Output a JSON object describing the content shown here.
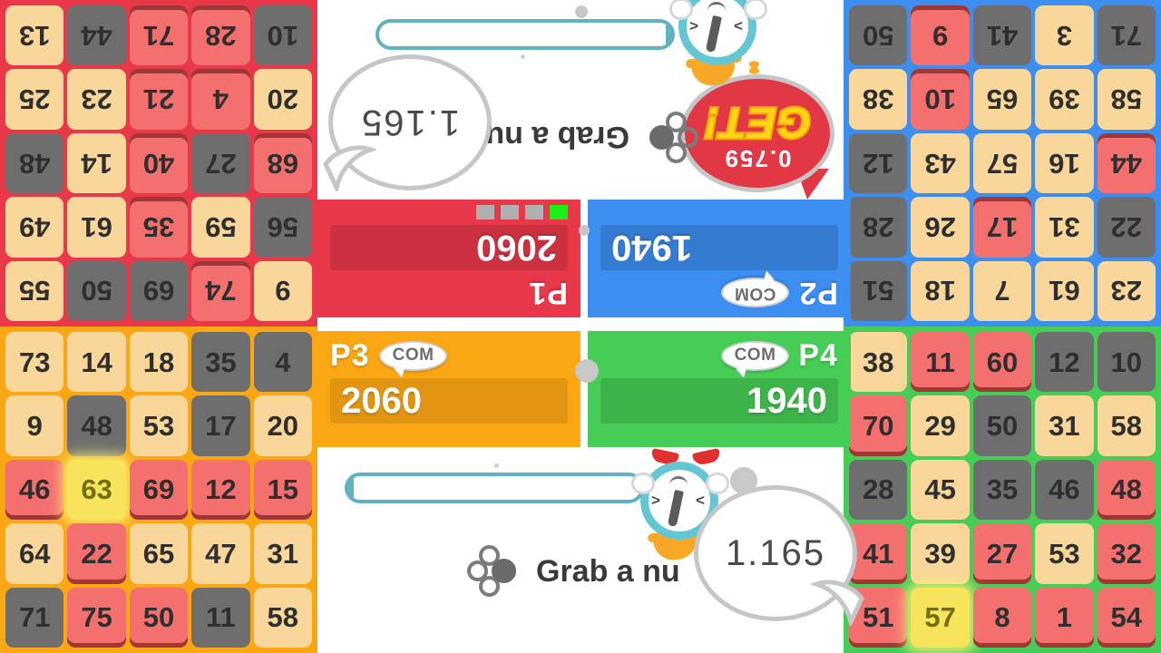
{
  "game": {
    "prompt_text": "Grab a nu",
    "get_label": "GET!",
    "get_time": "0.759",
    "bubble_top": "1.165",
    "bubble_bottom": "1.165",
    "icon_names": [
      "four-dot-icon",
      "clock-mascot-icon",
      "speech-bubble-icon"
    ]
  },
  "colors": {
    "p1": "#e8384a",
    "p2": "#3c8ef0",
    "p3": "#fba613",
    "p4": "#45cd55",
    "tile_cream": "#f9d79a",
    "tile_gray": "#6e6e6e",
    "tile_red": "#f4706f",
    "tile_highlight": "#f7e35c",
    "accent_teal": "#5fb3bf",
    "get_yellow": "#ffd417"
  },
  "players": [
    {
      "id": "p1",
      "name": "P1",
      "score": "2060",
      "com": false,
      "rotated": true,
      "progress_dots": [
        true,
        false,
        false,
        false
      ]
    },
    {
      "id": "p2",
      "name": "P2",
      "score": "1940",
      "com": true,
      "com_label": "COM",
      "rotated": true
    },
    {
      "id": "p3",
      "name": "P3",
      "score": "2060",
      "com": true,
      "com_label": "COM",
      "rotated": false
    },
    {
      "id": "p4",
      "name": "P4",
      "score": "1940",
      "com": true,
      "com_label": "COM",
      "rotated": false
    }
  ],
  "boards": {
    "p1": {
      "rows": [
        [
          {
            "v": "9",
            "s": "cream"
          },
          {
            "v": "74",
            "s": "red"
          },
          {
            "v": "69",
            "s": "gray"
          },
          {
            "v": "50",
            "s": "gray"
          },
          {
            "v": "55",
            "s": "cream"
          }
        ],
        [
          {
            "v": "56",
            "s": "gray"
          },
          {
            "v": "59",
            "s": "cream"
          },
          {
            "v": "35",
            "s": "red"
          },
          {
            "v": "61",
            "s": "cream"
          },
          {
            "v": "49",
            "s": "cream"
          }
        ],
        [
          {
            "v": "68",
            "s": "red"
          },
          {
            "v": "27",
            "s": "gray"
          },
          {
            "v": "40",
            "s": "red"
          },
          {
            "v": "14",
            "s": "cream"
          },
          {
            "v": "48",
            "s": "gray"
          }
        ],
        [
          {
            "v": "20",
            "s": "cream"
          },
          {
            "v": "4",
            "s": "red"
          },
          {
            "v": "21",
            "s": "red"
          },
          {
            "v": "23",
            "s": "cream"
          },
          {
            "v": "25",
            "s": "cream"
          }
        ],
        [
          {
            "v": "10",
            "s": "gray"
          },
          {
            "v": "28",
            "s": "red"
          },
          {
            "v": "71",
            "s": "red"
          },
          {
            "v": "44",
            "s": "gray"
          },
          {
            "v": "13",
            "s": "cream"
          }
        ]
      ]
    },
    "p2": {
      "rows": [
        [
          {
            "v": "23",
            "s": "cream"
          },
          {
            "v": "61",
            "s": "cream"
          },
          {
            "v": "7",
            "s": "cream"
          },
          {
            "v": "18",
            "s": "cream"
          },
          {
            "v": "51",
            "s": "gray"
          }
        ],
        [
          {
            "v": "22",
            "s": "gray"
          },
          {
            "v": "31",
            "s": "cream"
          },
          {
            "v": "17",
            "s": "red"
          },
          {
            "v": "26",
            "s": "cream"
          },
          {
            "v": "28",
            "s": "gray"
          }
        ],
        [
          {
            "v": "44",
            "s": "red"
          },
          {
            "v": "16",
            "s": "cream"
          },
          {
            "v": "57",
            "s": "cream"
          },
          {
            "v": "43",
            "s": "cream"
          },
          {
            "v": "12",
            "s": "gray"
          }
        ],
        [
          {
            "v": "58",
            "s": "cream"
          },
          {
            "v": "39",
            "s": "cream"
          },
          {
            "v": "65",
            "s": "cream"
          },
          {
            "v": "10",
            "s": "red"
          },
          {
            "v": "38",
            "s": "cream"
          }
        ],
        [
          {
            "v": "71",
            "s": "gray"
          },
          {
            "v": "3",
            "s": "cream"
          },
          {
            "v": "41",
            "s": "gray"
          },
          {
            "v": "9",
            "s": "red"
          },
          {
            "v": "50",
            "s": "gray"
          }
        ]
      ]
    },
    "p3": {
      "rows": [
        [
          {
            "v": "73",
            "s": "cream"
          },
          {
            "v": "14",
            "s": "cream"
          },
          {
            "v": "18",
            "s": "cream"
          },
          {
            "v": "35",
            "s": "gray"
          },
          {
            "v": "4",
            "s": "gray"
          }
        ],
        [
          {
            "v": "9",
            "s": "cream"
          },
          {
            "v": "48",
            "s": "gray"
          },
          {
            "v": "53",
            "s": "cream"
          },
          {
            "v": "17",
            "s": "gray"
          },
          {
            "v": "20",
            "s": "cream"
          }
        ],
        [
          {
            "v": "46",
            "s": "red"
          },
          {
            "v": "63",
            "s": "highlight"
          },
          {
            "v": "69",
            "s": "red"
          },
          {
            "v": "12",
            "s": "red"
          },
          {
            "v": "15",
            "s": "red"
          }
        ],
        [
          {
            "v": "64",
            "s": "cream"
          },
          {
            "v": "22",
            "s": "red"
          },
          {
            "v": "65",
            "s": "cream"
          },
          {
            "v": "47",
            "s": "cream"
          },
          {
            "v": "31",
            "s": "cream"
          }
        ],
        [
          {
            "v": "71",
            "s": "gray"
          },
          {
            "v": "75",
            "s": "red"
          },
          {
            "v": "50",
            "s": "red"
          },
          {
            "v": "11",
            "s": "gray"
          },
          {
            "v": "58",
            "s": "cream"
          }
        ]
      ]
    },
    "p4": {
      "rows": [
        [
          {
            "v": "38",
            "s": "cream"
          },
          {
            "v": "11",
            "s": "red"
          },
          {
            "v": "60",
            "s": "red"
          },
          {
            "v": "12",
            "s": "gray"
          },
          {
            "v": "10",
            "s": "gray"
          }
        ],
        [
          {
            "v": "70",
            "s": "red"
          },
          {
            "v": "29",
            "s": "cream"
          },
          {
            "v": "50",
            "s": "gray"
          },
          {
            "v": "31",
            "s": "cream"
          },
          {
            "v": "58",
            "s": "cream"
          }
        ],
        [
          {
            "v": "28",
            "s": "gray"
          },
          {
            "v": "45",
            "s": "cream"
          },
          {
            "v": "35",
            "s": "gray"
          },
          {
            "v": "46",
            "s": "gray"
          },
          {
            "v": "48",
            "s": "red"
          }
        ],
        [
          {
            "v": "41",
            "s": "red"
          },
          {
            "v": "39",
            "s": "cream"
          },
          {
            "v": "27",
            "s": "red"
          },
          {
            "v": "53",
            "s": "cream"
          },
          {
            "v": "32",
            "s": "red"
          }
        ],
        [
          {
            "v": "51",
            "s": "red"
          },
          {
            "v": "57",
            "s": "highlight"
          },
          {
            "v": "8",
            "s": "red"
          },
          {
            "v": "1",
            "s": "red"
          },
          {
            "v": "54",
            "s": "red"
          }
        ]
      ]
    }
  }
}
